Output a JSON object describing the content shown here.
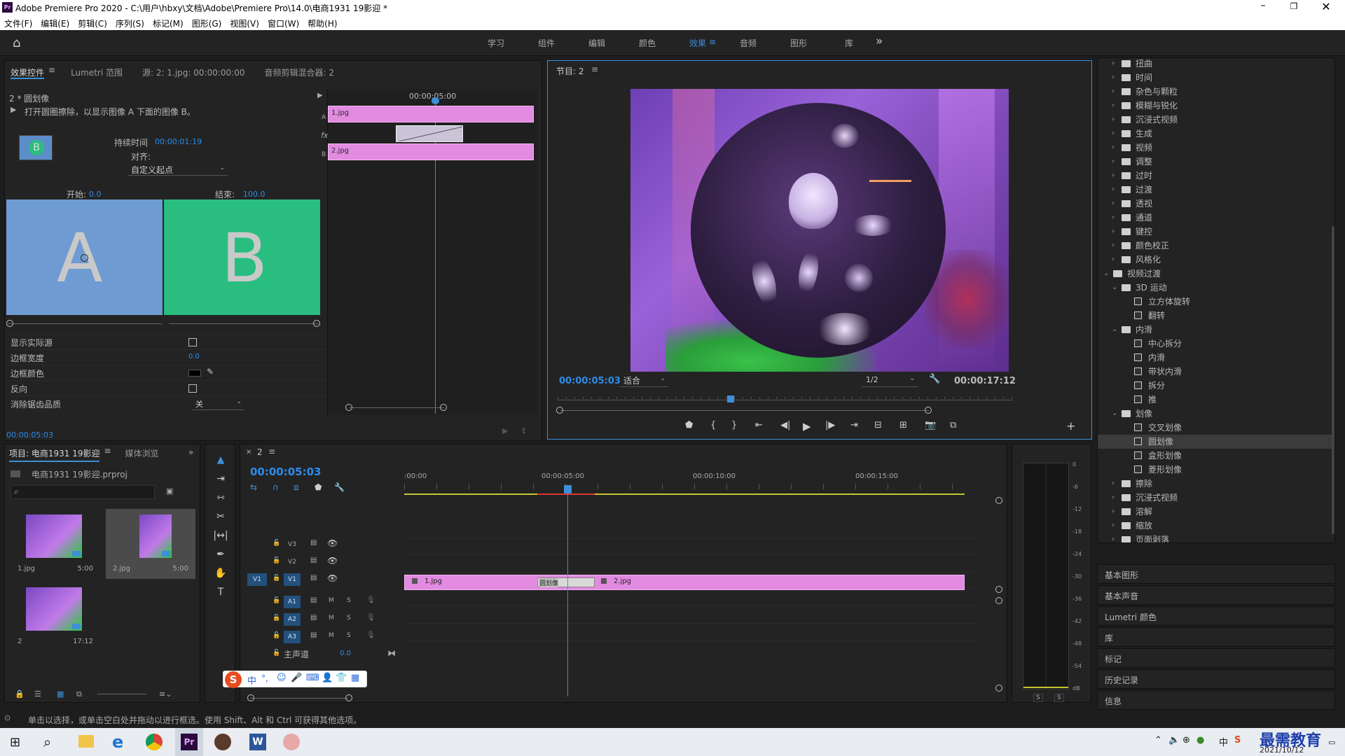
{
  "app": {
    "title": "Adobe Premiere Pro 2020 - C:\\用户\\hbxy\\文档\\Adobe\\Premiere Pro\\14.0\\电商1931 19影迎 *",
    "logo": "Pr"
  },
  "menu": [
    "文件(F)",
    "编辑(E)",
    "剪辑(C)",
    "序列(S)",
    "标记(M)",
    "图形(G)",
    "视图(V)",
    "窗口(W)",
    "帮助(H)"
  ],
  "workspaces": {
    "items": [
      "学习",
      "组件",
      "编辑",
      "颜色",
      "效果",
      "音频",
      "图形",
      "库"
    ],
    "active": "效果",
    "more": "»"
  },
  "effect_controls": {
    "tabs": [
      "效果控件",
      "Lumetri 范围",
      "源: 2: 1.jpg: 00:00:00:00",
      "音频剪辑混合器: 2"
    ],
    "clip_label": "2 * 圆划像",
    "description": "打开圆圈擦除，以显示图像 A 下面的图像 B。",
    "duration_label": "持续时间",
    "duration_value": "00:00:01:19",
    "align_label": "对齐:",
    "align_value": "自定义起点",
    "start_label": "开始:",
    "start_value": "0.0",
    "end_label": "结束:",
    "end_value": "100.0",
    "a_letter": "A",
    "b_letter": "B",
    "thumb_letter": "B",
    "props": [
      {
        "label": "显示实际源",
        "type": "checkbox"
      },
      {
        "label": "边框宽度",
        "type": "value",
        "value": "0.0"
      },
      {
        "label": "边框颜色",
        "type": "color"
      },
      {
        "label": "反向",
        "type": "checkbox"
      },
      {
        "label": "消除锯齿品质",
        "type": "select",
        "value": "关"
      }
    ],
    "timecode": "00:00:05:03",
    "mini_timeline": {
      "ruler_time": "00:00:05:00",
      "clip_a": "1.jpg",
      "clip_b": "2.jpg",
      "label_a": "A",
      "label_b": "B",
      "fx": "fx"
    }
  },
  "program": {
    "title": "节目: 2",
    "timecode": "00:00:05:03",
    "fit": "适合",
    "resolution": "1/2",
    "duration": "00:00:17:12"
  },
  "effects_tree": [
    {
      "indent": 1,
      "kind": "folder",
      "label": "扭曲",
      "open": false
    },
    {
      "indent": 1,
      "kind": "folder",
      "label": "时间",
      "open": false
    },
    {
      "indent": 1,
      "kind": "folder",
      "label": "杂色与颗粒",
      "open": false
    },
    {
      "indent": 1,
      "kind": "folder",
      "label": "模糊与锐化",
      "open": false
    },
    {
      "indent": 1,
      "kind": "folder",
      "label": "沉浸式视频",
      "open": false
    },
    {
      "indent": 1,
      "kind": "folder",
      "label": "生成",
      "open": false
    },
    {
      "indent": 1,
      "kind": "folder",
      "label": "视频",
      "open": false
    },
    {
      "indent": 1,
      "kind": "folder",
      "label": "调整",
      "open": false
    },
    {
      "indent": 1,
      "kind": "folder",
      "label": "过时",
      "open": false
    },
    {
      "indent": 1,
      "kind": "folder",
      "label": "过渡",
      "open": false
    },
    {
      "indent": 1,
      "kind": "folder",
      "label": "透视",
      "open": false
    },
    {
      "indent": 1,
      "kind": "folder",
      "label": "通道",
      "open": false
    },
    {
      "indent": 1,
      "kind": "folder",
      "label": "键控",
      "open": false
    },
    {
      "indent": 1,
      "kind": "folder",
      "label": "颜色校正",
      "open": false
    },
    {
      "indent": 1,
      "kind": "folder",
      "label": "风格化",
      "open": false
    },
    {
      "indent": 0,
      "kind": "folder",
      "label": "视频过渡",
      "open": true
    },
    {
      "indent": 1,
      "kind": "folder",
      "label": "3D 运动",
      "open": true
    },
    {
      "indent": 2,
      "kind": "fx",
      "label": "立方体旋转"
    },
    {
      "indent": 2,
      "kind": "fx",
      "label": "翻转"
    },
    {
      "indent": 1,
      "kind": "folder",
      "label": "内滑",
      "open": true
    },
    {
      "indent": 2,
      "kind": "fx",
      "label": "中心拆分"
    },
    {
      "indent": 2,
      "kind": "fx",
      "label": "内滑"
    },
    {
      "indent": 2,
      "kind": "fx",
      "label": "带状内滑"
    },
    {
      "indent": 2,
      "kind": "fx",
      "label": "拆分"
    },
    {
      "indent": 2,
      "kind": "fx",
      "label": "推"
    },
    {
      "indent": 1,
      "kind": "folder",
      "label": "划像",
      "open": true
    },
    {
      "indent": 2,
      "kind": "fx",
      "label": "交叉划像"
    },
    {
      "indent": 2,
      "kind": "fx",
      "label": "圆划像",
      "selected": true
    },
    {
      "indent": 2,
      "kind": "fx",
      "label": "盒形划像"
    },
    {
      "indent": 2,
      "kind": "fx",
      "label": "菱形划像"
    },
    {
      "indent": 1,
      "kind": "folder",
      "label": "擦除",
      "open": false
    },
    {
      "indent": 1,
      "kind": "folder",
      "label": "沉浸式视频",
      "open": false
    },
    {
      "indent": 1,
      "kind": "folder",
      "label": "溶解",
      "open": false
    },
    {
      "indent": 1,
      "kind": "folder",
      "label": "缩放",
      "open": false
    },
    {
      "indent": 1,
      "kind": "folder",
      "label": "页面剥落",
      "open": false
    }
  ],
  "side_panels": [
    "基本图形",
    "基本声音",
    "Lumetri 颜色",
    "库",
    "标记",
    "历史记录",
    "信息"
  ],
  "project": {
    "tabs": [
      "项目: 电商1931 19影迎",
      "媒体浏览"
    ],
    "file": "电商1931 19影迎.prproj",
    "items": [
      {
        "name": "1.jpg",
        "dur": "5:00"
      },
      {
        "name": "2.jpg",
        "dur": "5:00"
      },
      {
        "name": "2",
        "dur": "17:12"
      }
    ]
  },
  "timeline": {
    "tab": "2",
    "timecode": "00:00:05:03",
    "ruler": [
      ":00:00",
      "00:00:05:00",
      "00:00:10:00",
      "00:00:15:00"
    ],
    "video_tracks": [
      "V3",
      "V2",
      "V1"
    ],
    "audio_tracks": [
      "A1",
      "A2",
      "A3"
    ],
    "source_patch": "V1",
    "m": "M",
    "s": "S",
    "master_label": "主声道",
    "master_value": "0.0",
    "clip1": "1.jpg",
    "clip2": "2.jpg",
    "transition": "圆划像"
  },
  "meter": {
    "labels": [
      "0",
      "-6",
      "-12",
      "-18",
      "-24",
      "-30",
      "-36",
      "-42",
      "-48",
      "-54",
      "dB"
    ],
    "s1": "S",
    "s2": "S"
  },
  "ime": {
    "mode": "中",
    "extra": "°,"
  },
  "status": "单击以选择，或单击空白处并拖动以进行框选。使用 Shift、Alt 和 Ctrl 可获得其他选项。",
  "tray": {
    "ime": "中",
    "ime2": "S",
    "date": "2021/10/12",
    "watermark": "最需教育"
  },
  "taskbar": {
    "word": "W",
    "pr": "Pr"
  }
}
